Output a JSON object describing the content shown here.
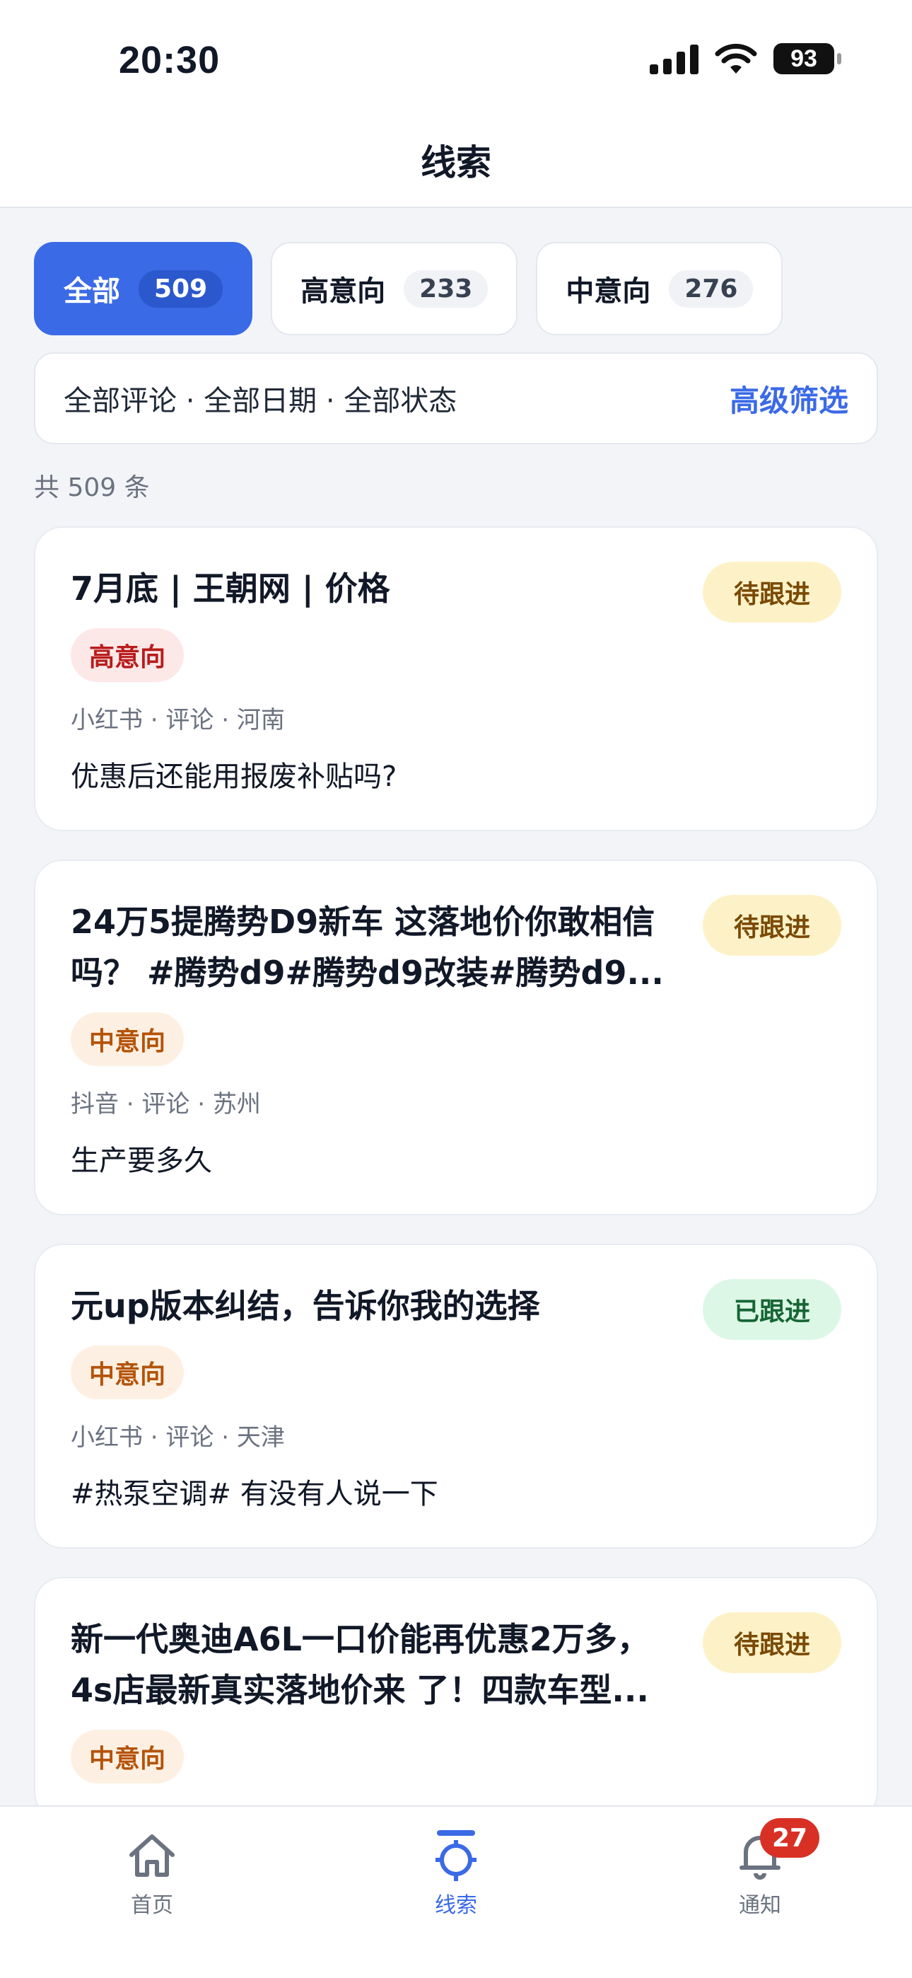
{
  "status_bar": {
    "time": "20:30",
    "battery": "93"
  },
  "header": {
    "title": "线索"
  },
  "tabs": [
    {
      "label": "全部",
      "count": "509",
      "active": true
    },
    {
      "label": "高意向",
      "count": "233",
      "active": false
    },
    {
      "label": "中意向",
      "count": "276",
      "active": false
    }
  ],
  "filters": {
    "summary": "全部评论 · 全部日期 · 全部状态",
    "advanced_label": "高级筛选"
  },
  "total_text": "共 509 条",
  "cards": [
    {
      "title": "7月底 | 王朝网 | 价格",
      "status": "待跟进",
      "intent": "高意向",
      "meta": "小红书 · 评论 · 河南",
      "snippet": "优惠后还能用报废补贴吗?"
    },
    {
      "title": "24万5提腾势D9新车 这落地价你敢相信吗？ #腾势d9#腾势d9改装#腾势d9...",
      "status": "待跟进",
      "intent": "中意向",
      "meta": "抖音 · 评论 · 苏州",
      "snippet": "生产要多久"
    },
    {
      "title": "元up版本纠结，告诉你我的选择",
      "status": "已跟进",
      "intent": "中意向",
      "meta": "小红书 · 评论 · 天津",
      "snippet": "#热泵空调# 有没有人说一下"
    },
    {
      "title": "新一代奥迪A6L一口价能再优惠2万多，4s店最新真实落地价来 了！四款车型...",
      "status": "待跟进",
      "intent": "中意向",
      "meta": "",
      "snippet": ""
    }
  ],
  "bottom_nav": {
    "items": [
      {
        "label": "首页"
      },
      {
        "label": "线索"
      },
      {
        "label": "通知",
        "badge": "27"
      }
    ]
  }
}
